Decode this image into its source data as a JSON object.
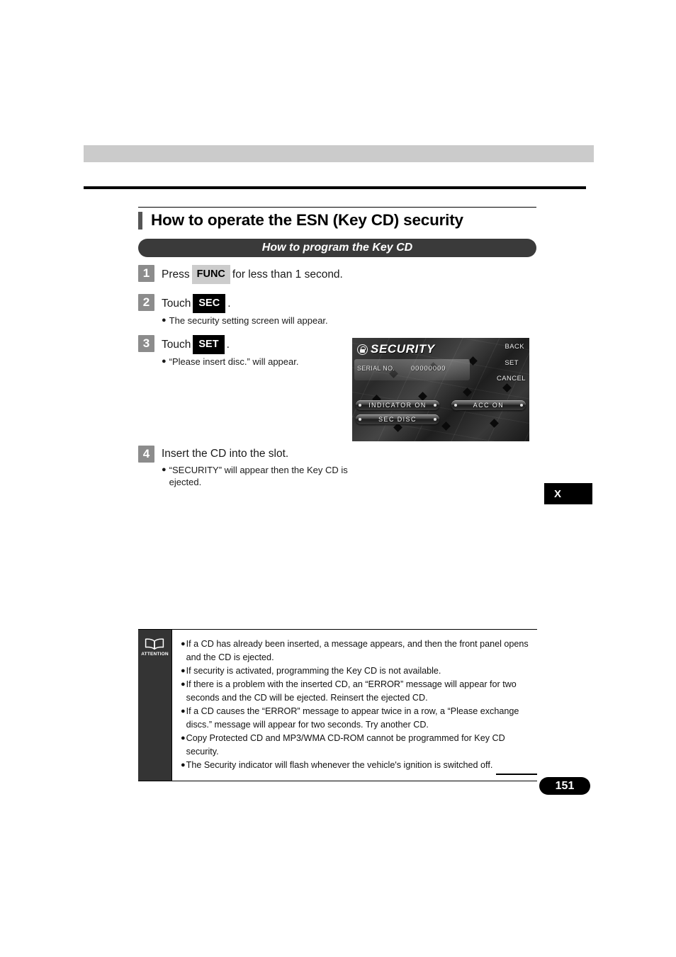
{
  "page": {
    "number": "151",
    "thumb_index": "X"
  },
  "section": {
    "title": "How to operate the ESN (Key CD) security",
    "subheading": "How to program the Key CD"
  },
  "steps": [
    {
      "number": "1",
      "text_before": "Press",
      "key": "FUNC",
      "key_style": "light",
      "text_after": "for less than 1 second.",
      "bullets": []
    },
    {
      "number": "2",
      "text_before": "Touch",
      "key": "SEC",
      "key_style": "dark",
      "text_after": ".",
      "bullets": [
        "The security setting screen will appear."
      ]
    },
    {
      "number": "3",
      "text_before": "Touch",
      "key": "SET",
      "key_style": "dark",
      "text_after": ".",
      "bullets": [
        "“Please insert disc.” will appear."
      ]
    },
    {
      "number": "4",
      "text_before": "Insert the CD into the slot.",
      "key": "",
      "key_style": "none",
      "text_after": "",
      "bullets": [
        "“SECURITY” will appear then the Key CD is ejected."
      ]
    }
  ],
  "device_screen": {
    "title": "SECURITY",
    "serial_label": "SERIAL NO.",
    "serial_value": "00000000",
    "corner_buttons": [
      "BACK",
      "SET",
      "CANCEL"
    ],
    "pill_buttons": [
      "INDICATOR ON",
      "ACC ON",
      "SEC DISC"
    ]
  },
  "attention": {
    "label": "ATTENTION",
    "items": [
      "If a CD has already been inserted, a message appears, and then the front panel opens and the CD is ejected.",
      "If security is activated, programming the Key CD is not available.",
      "If there is a problem with the inserted CD, an “ERROR” message will appear for two seconds and the CD will be ejected. Reinsert the ejected CD.",
      "If a CD causes the “ERROR” message to appear twice in a row, a “Please exchange discs.” message will appear for two seconds. Try another CD.",
      "Copy Protected CD and MP3/WMA CD-ROM cannot be programmed for Key CD security.",
      "The Security indicator will flash whenever the vehicle's ignition is switched off."
    ]
  },
  "colors": {
    "header_band": "#cbcbcb",
    "subheading_bg": "#3a3a3a",
    "step_badge": "#8c8c8c",
    "key_light": "#cccccc",
    "key_dark": "#000000",
    "note_side": "#343434"
  }
}
